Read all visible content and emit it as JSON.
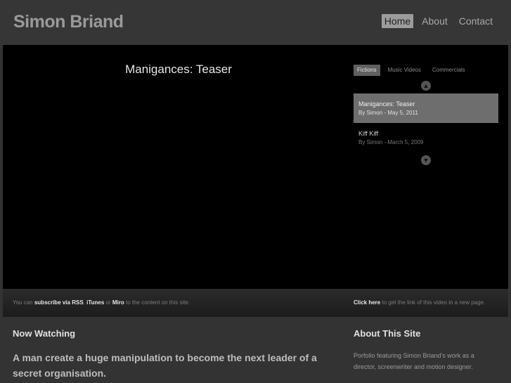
{
  "header": {
    "site_title": "Simon Briand",
    "nav": [
      {
        "label": "Home",
        "active": true
      },
      {
        "label": "About",
        "active": false
      },
      {
        "label": "Contact",
        "active": false
      }
    ]
  },
  "player": {
    "video_title": "Manigances: Teaser",
    "tabs": [
      {
        "label": "Fictions",
        "active": true
      },
      {
        "label": "Music Videos",
        "active": false
      },
      {
        "label": "Commercials",
        "active": false
      }
    ],
    "scroll_up_icon": "arrow-up-icon",
    "scroll_down_icon": "arrow-down-icon",
    "videos": [
      {
        "title": "Manigances: Teaser",
        "meta": "By Simon - May 5, 2011",
        "active": true
      },
      {
        "title": "Kiff Kiff",
        "meta": "By Simon - March 5, 2009",
        "active": false
      }
    ]
  },
  "subscribe_bar": {
    "prefix": "You can ",
    "subscribe_link": "subscribe via RSS",
    "sep1": ", ",
    "itunes_link": "iTunes",
    "sep2": " or ",
    "miro_link": "Miro",
    "suffix": " to the content on this site.",
    "click_here_link": "Click here",
    "click_here_suffix": " to get the link of this video in a new page."
  },
  "now_watching": {
    "heading": "Now Watching",
    "description": "A man create a huge manipulation to become the next leader of a secret organisation."
  },
  "about": {
    "heading": "About This Site",
    "text": "Porfolio featuring Simon Briand's work as a director, screenwriter and motion designer."
  },
  "colors": {
    "page_bg": "#333333",
    "stage_bg": "#000000",
    "active_item_bg": "#6e6e6e",
    "active_nav_bg": "#9c9c9c"
  }
}
